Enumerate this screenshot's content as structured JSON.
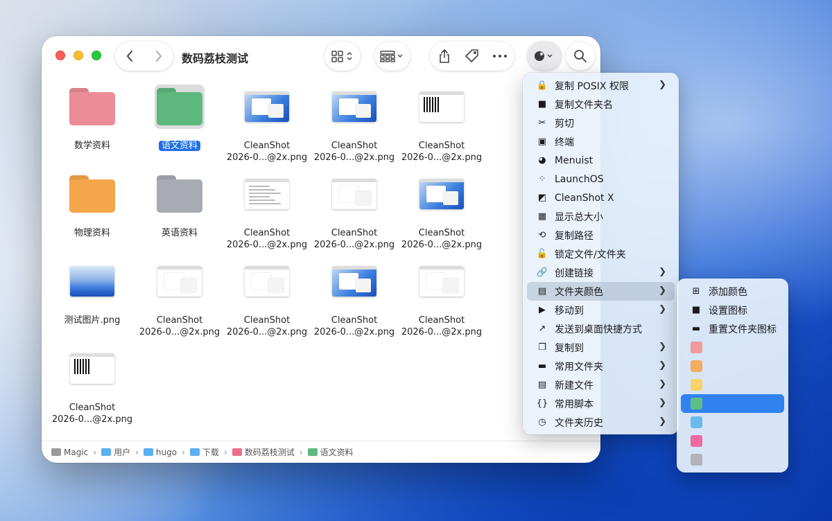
{
  "window": {
    "title": "数码荔枝测试",
    "nav": {
      "back": "chevron-left-icon",
      "forward": "chevron-right-icon"
    }
  },
  "files": [
    {
      "label": "数学资料",
      "kind": "folder",
      "color": "#ec8c96"
    },
    {
      "label": "语文资料",
      "kind": "folder",
      "color": "#5db87d",
      "selected": true
    },
    {
      "label": "CleanShot\n2026-0...@2x.png",
      "kind": "shot-blue"
    },
    {
      "label": "CleanShot\n2026-0...@2x.png",
      "kind": "shot-blue"
    },
    {
      "label": "CleanShot\n2026-0...@2x.png",
      "kind": "shot-qr"
    },
    {
      "label": "物理资料",
      "kind": "folder",
      "color": "#f3a64a"
    },
    {
      "label": "英语资料",
      "kind": "folder",
      "color": "#a9abb3"
    },
    {
      "label": "CleanShot\n2026-0...@2x.png",
      "kind": "shot-doc"
    },
    {
      "label": "CleanShot\n2026-0...@2x.png",
      "kind": "shot-white"
    },
    {
      "label": "CleanShot\n2026-0...@2x.png",
      "kind": "shot-blue"
    },
    {
      "label": "测试图片.png",
      "kind": "picture"
    },
    {
      "label": "CleanShot\n2026-0...@2x.png",
      "kind": "shot-white"
    },
    {
      "label": "CleanShot\n2026-0...@2x.png",
      "kind": "shot-white"
    },
    {
      "label": "CleanShot\n2026-0...@2x.png",
      "kind": "shot-blue"
    },
    {
      "label": "CleanShot\n2026-0...@2x.png",
      "kind": "shot-white"
    },
    {
      "label": "CleanShot\n2026-0...@2x.png",
      "kind": "shot-qr"
    }
  ],
  "pathbar": [
    {
      "label": "Magic",
      "color": "#9a9a9a"
    },
    {
      "label": "用户",
      "color": "#5ab0f0"
    },
    {
      "label": "hugo",
      "color": "#5ab0f0"
    },
    {
      "label": "下载",
      "color": "#5ab0f0"
    },
    {
      "label": "数码荔枝测试",
      "color": "#ec6f8a"
    },
    {
      "label": "语文资料",
      "color": "#5db87d"
    }
  ],
  "context_menu": [
    {
      "label": "复制 POSIX 权限",
      "icon": "lock-icon",
      "glyph": "🔒",
      "submenu": true
    },
    {
      "label": "复制文件夹名",
      "icon": "black-square-icon",
      "glyph": "■",
      "submenu": false
    },
    {
      "label": "剪切",
      "icon": "scissors-icon",
      "glyph": "✂",
      "submenu": false
    },
    {
      "label": "终端",
      "icon": "terminal-icon",
      "glyph": "▣",
      "submenu": false
    },
    {
      "label": "Menuist",
      "icon": "menuist-icon",
      "glyph": "◕",
      "submenu": false
    },
    {
      "label": "LaunchOS",
      "icon": "launchos-icon",
      "glyph": "⁘",
      "submenu": false
    },
    {
      "label": "CleanShot X",
      "icon": "cleanshot-icon",
      "glyph": "◩",
      "submenu": false
    },
    {
      "label": "显示总大小",
      "icon": "size-icon",
      "glyph": "▦",
      "submenu": false
    },
    {
      "label": "复制路径",
      "icon": "path-icon",
      "glyph": "⟲",
      "submenu": false
    },
    {
      "label": "锁定文件/文件夹",
      "icon": "unlock-icon",
      "glyph": "🔓",
      "submenu": false
    },
    {
      "label": "创建链接",
      "icon": "link-icon",
      "glyph": "🔗",
      "submenu": true
    },
    {
      "label": "文件夹颜色",
      "icon": "folder-color-icon",
      "glyph": "▤",
      "submenu": true,
      "highlighted": true
    },
    {
      "label": "移动到",
      "icon": "move-icon",
      "glyph": "▶",
      "submenu": true
    },
    {
      "label": "发送到桌面快捷方式",
      "icon": "shortcut-icon",
      "glyph": "↗",
      "submenu": false
    },
    {
      "label": "复制到",
      "icon": "copy-icon",
      "glyph": "❐",
      "submenu": true
    },
    {
      "label": "常用文件夹",
      "icon": "folder-icon",
      "glyph": "▬",
      "submenu": true
    },
    {
      "label": "新建文件",
      "icon": "new-file-icon",
      "glyph": "▤",
      "submenu": true
    },
    {
      "label": "常用脚本",
      "icon": "script-icon",
      "glyph": "{}",
      "submenu": true
    },
    {
      "label": "文件夹历史",
      "icon": "history-icon",
      "glyph": "◷",
      "submenu": true
    }
  ],
  "color_submenu": {
    "actions": [
      {
        "label": "添加颜色",
        "icon": "plus-square-icon",
        "glyph": "⊞"
      },
      {
        "label": "设置图标",
        "icon": "black-square-icon",
        "glyph": "■"
      },
      {
        "label": "重置文件夹图标",
        "icon": "folder-icon",
        "glyph": "▬"
      }
    ],
    "swatches": [
      "#f29a9a",
      "#f4ad62",
      "#f7d36a",
      "#5fbf87",
      "#6cb9ee",
      "#ef6aa0",
      "#b3b3b8"
    ],
    "selected_swatch": 3
  }
}
